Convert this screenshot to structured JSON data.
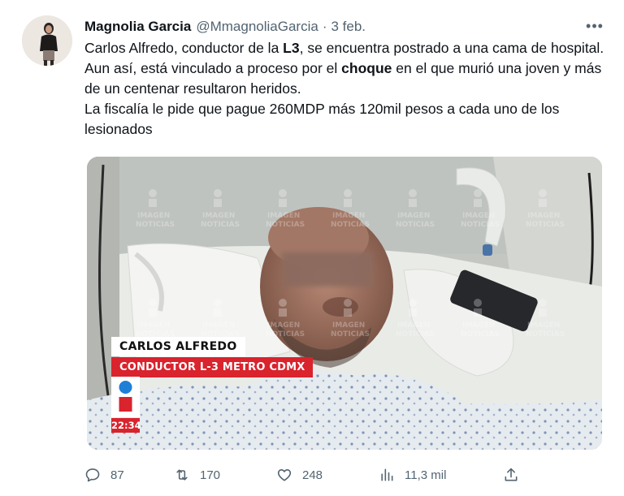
{
  "tweet": {
    "author_name": "Magnolia Garcia",
    "handle": "@MmagnoliaGarcia",
    "separator": "·",
    "date": "3 feb.",
    "more_icon": "more-horizontal-icon",
    "text": {
      "line1_a": "Carlos Alfredo, conductor de la ",
      "line1_b": "L3",
      "line1_c": ", se encuentra postrado a una cama de hospital. Aun así, está vinculado a proceso por el ",
      "line1_d": "choque",
      "line1_e": " en el que murió una joven y más de un centenar resultaron heridos.",
      "line2": "La fiscalía le pide que pague 260MDP más 120mil pesos a cada uno de los lesionados"
    },
    "media": {
      "caption_name": "CARLOS ALFREDO",
      "caption_role": "CONDUCTOR L-3 METRO CDMX",
      "clock": "22:34",
      "watermark_line1": "IMAGEN",
      "watermark_line2": "NOTICIAS"
    },
    "actions": {
      "replies": "87",
      "retweets": "170",
      "likes": "248",
      "views": "11,3 mil"
    }
  },
  "colors": {
    "text_primary": "#0f1419",
    "text_secondary": "#536471",
    "news_red": "#d9232d"
  }
}
